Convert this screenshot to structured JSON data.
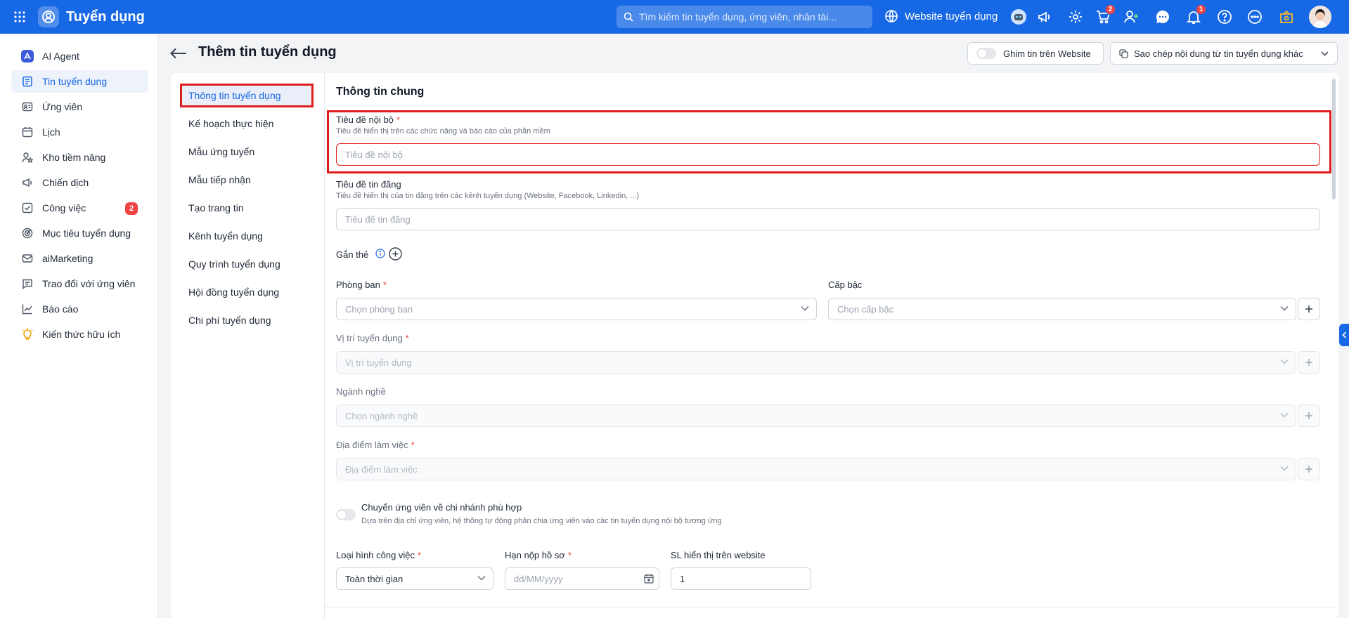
{
  "app": {
    "title": "Tuyển dụng"
  },
  "search": {
    "placeholder": "Tìm kiếm tin tuyển dụng, ứng viên, nhân tài..."
  },
  "topbar": {
    "website_label": "Website tuyển dụng",
    "cart_badge": "2",
    "notification_badge": "1",
    "icons": [
      "apps-grid-icon",
      "globe-icon",
      "robot-icon",
      "megaphone-icon",
      "gear-icon",
      "cart-icon",
      "add-user-icon",
      "chat-icon",
      "bell-icon",
      "help-icon",
      "more-icon",
      "badge-icon"
    ]
  },
  "sidebar": {
    "items": [
      {
        "label": "AI Agent",
        "icon": "ai-agent-icon"
      },
      {
        "label": "Tin tuyển dụng",
        "icon": "job-post-icon",
        "active": true
      },
      {
        "label": "Ứng viên",
        "icon": "candidate-icon"
      },
      {
        "label": "Lịch",
        "icon": "calendar-icon"
      },
      {
        "label": "Kho tiềm năng",
        "icon": "talent-pool-icon"
      },
      {
        "label": "Chiến dịch",
        "icon": "campaign-icon"
      },
      {
        "label": "Công việc",
        "icon": "task-icon",
        "badge": "2"
      },
      {
        "label": "Mục tiêu tuyển dụng",
        "icon": "target-icon"
      },
      {
        "label": "aiMarketing",
        "icon": "mail-icon"
      },
      {
        "label": "Trao đổi với ứng viên",
        "icon": "message-icon"
      },
      {
        "label": "Báo cáo",
        "icon": "report-icon"
      },
      {
        "label": "Kiến thức hữu ích",
        "icon": "lightbulb-icon"
      }
    ]
  },
  "page": {
    "title": "Thêm tin tuyển dụng",
    "pin_label": "Ghim tin trên Website",
    "copy_label": "Sao chép nội dung từ tin tuyển dụng khác"
  },
  "subnav": [
    "Thông tin tuyển dụng",
    "Kế hoạch thực hiện",
    "Mẫu ứng tuyển",
    "Mẫu tiếp nhận",
    "Tạo trang tin",
    "Kênh tuyển dụng",
    "Quy trình tuyển dụng",
    "Hội đồng tuyển dụng",
    "Chi phí tuyển dụng"
  ],
  "form": {
    "section_title": "Thông tin chung",
    "internal_title": {
      "label": "Tiêu đề nội bộ",
      "hint": "Tiêu đề hiển thị trên các chức năng và báo cáo của phần mềm",
      "placeholder": "Tiêu đề nội bộ"
    },
    "posting_title": {
      "label": "Tiêu đề tin đăng",
      "hint": "Tiêu đề hiển thị của tin đăng trên các kênh tuyển dụng (Website, Facebook, Linkedin, ...)",
      "placeholder": "Tiêu đề tin đăng"
    },
    "tags": {
      "label": "Gắn thẻ"
    },
    "department": {
      "label": "Phòng ban",
      "placeholder": "Chọn phòng ban"
    },
    "level": {
      "label": "Cấp bậc",
      "placeholder": "Chọn cấp bậc"
    },
    "position": {
      "label": "Vị trí tuyển dụng",
      "placeholder": "Vị trí tuyển dụng"
    },
    "industry": {
      "label": "Ngành nghề",
      "placeholder": "Chọn ngành nghề"
    },
    "location": {
      "label": "Địa điểm làm việc",
      "placeholder": "Địa điểm làm việc"
    },
    "branch_toggle": {
      "label": "Chuyển ứng viên về chi nhánh phù hợp",
      "hint": "Dựa trên địa chỉ ứng viên, hệ thống tự động phân chia ứng viên vào các tin tuyển dụng nội bộ tương ứng",
      "on": false
    },
    "job_type": {
      "label": "Loại hình công việc",
      "value": "Toàn thời gian"
    },
    "deadline": {
      "label": "Hạn nộp hồ sơ",
      "placeholder": "dd/MM/yyyy"
    },
    "display_count": {
      "label": "SL hiển thị trên website",
      "value": "1"
    }
  },
  "colors": {
    "brand": "#1768e5",
    "highlight": "#e01d1d",
    "badge": "#ef4444"
  }
}
